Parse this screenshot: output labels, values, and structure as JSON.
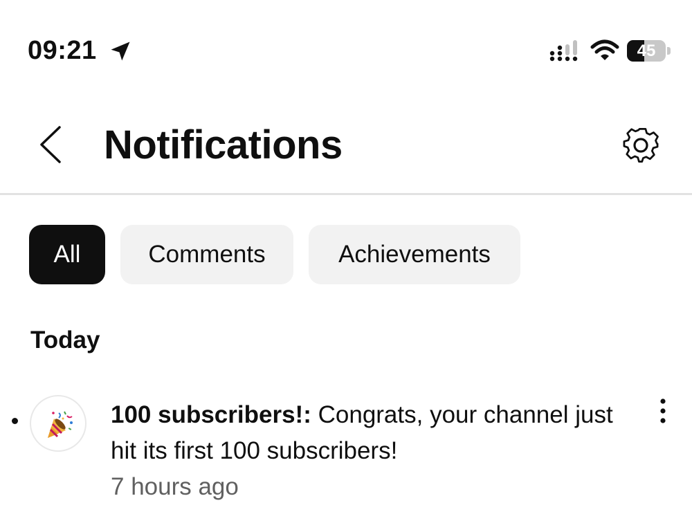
{
  "status_bar": {
    "time": "09:21",
    "battery_level": "45",
    "battery_fraction": 0.45
  },
  "header": {
    "title": "Notifications"
  },
  "filters": {
    "chips": [
      "All",
      "Comments",
      "Achievements"
    ],
    "selected": "All"
  },
  "section": {
    "heading": "Today"
  },
  "notifications": [
    {
      "title": "100 subscribers!:",
      "message": "Congrats, your channel just hit its first 100 subscribers!",
      "time": "7 hours ago",
      "unread": true,
      "icon": "party-popper-icon"
    }
  ],
  "icons": {
    "back": "chevron-left-icon",
    "settings": "gear-icon",
    "more": "more-vertical-icon",
    "location": "location-arrow-icon",
    "signal": "cellular-signal-icon",
    "wifi": "wifi-icon"
  },
  "colors": {
    "chip_selected_bg": "#0f0f0f",
    "chip_bg": "#f2f2f2",
    "secondary_text": "#606060"
  }
}
